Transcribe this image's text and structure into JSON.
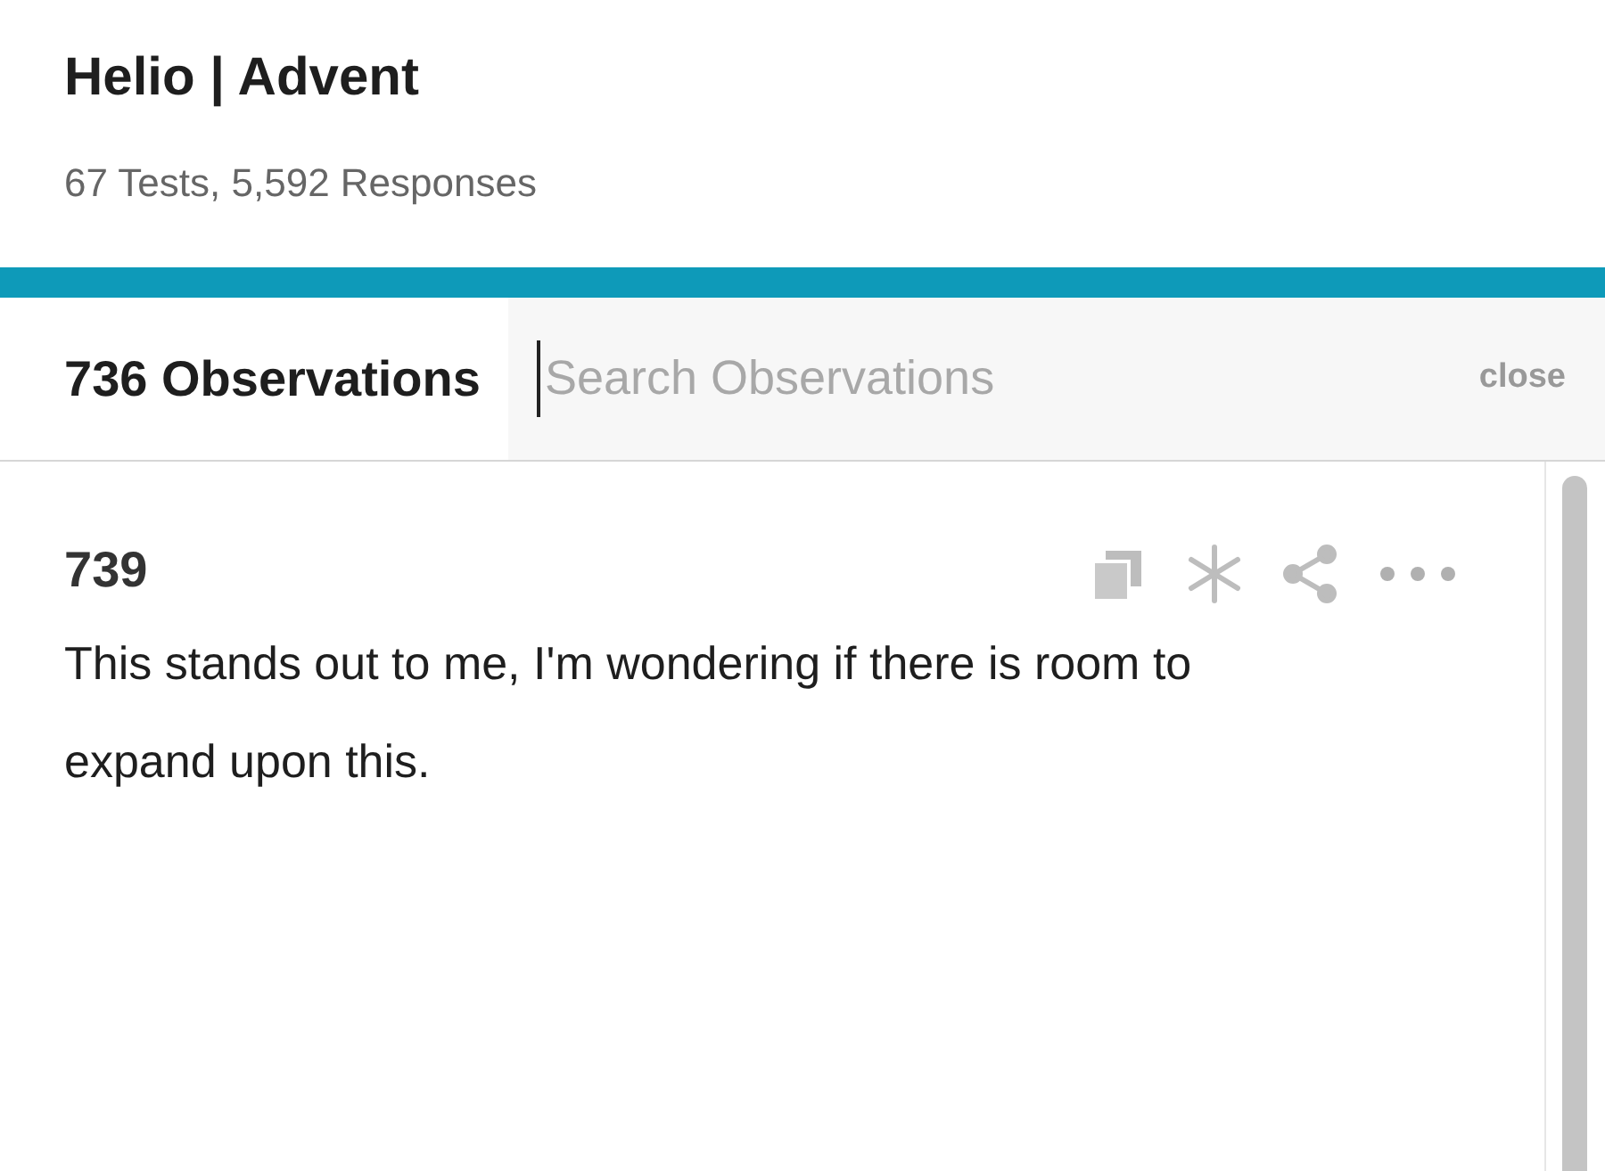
{
  "project": {
    "title": "Helio | Advent",
    "subtitle": "67 Tests, 5,592 Responses"
  },
  "observations_bar": {
    "count_label": "736 Observations",
    "search": {
      "placeholder": "Search Observations"
    },
    "close": "close"
  },
  "observations": [
    {
      "number": "739",
      "text": "This stands out to me, I'm wondering if there is room to expand upon this."
    }
  ]
}
